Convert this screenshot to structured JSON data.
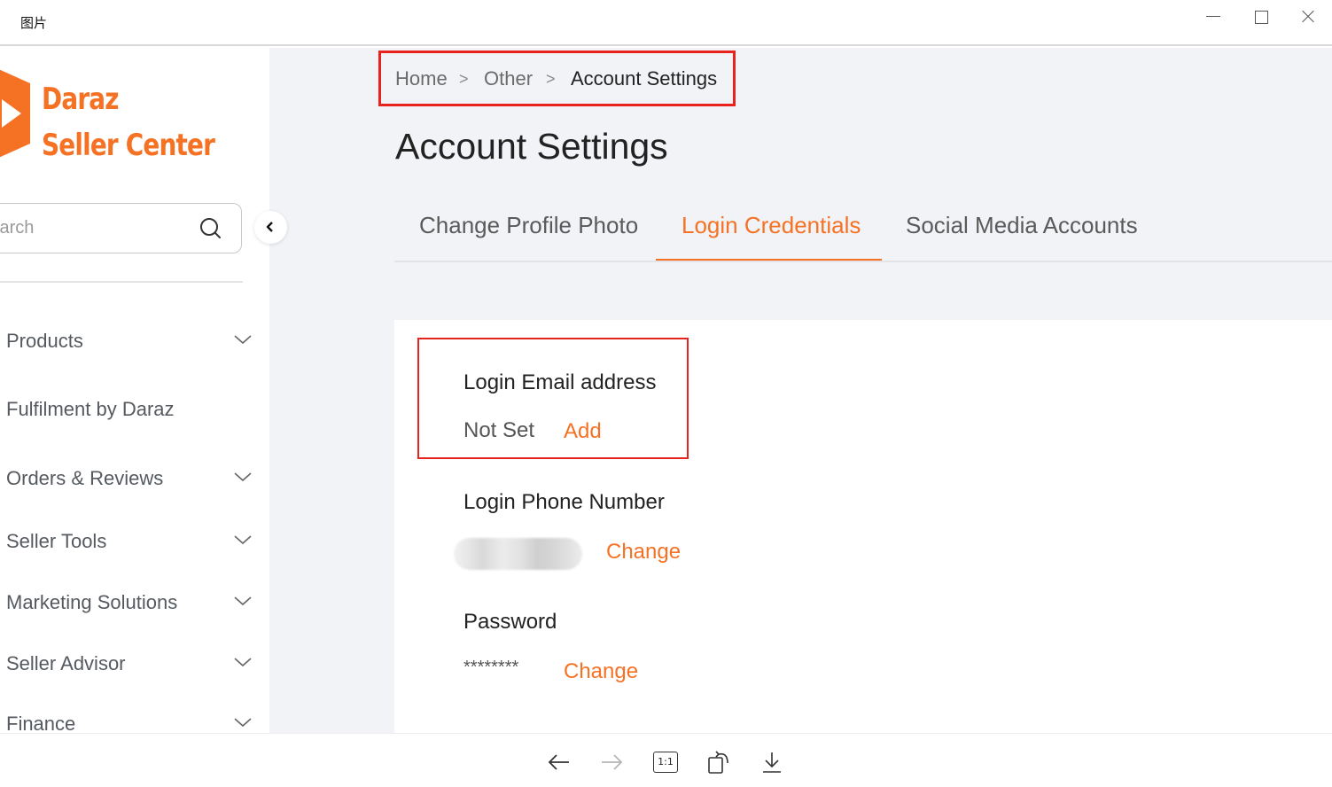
{
  "window": {
    "title": "图片"
  },
  "sidebar": {
    "logo_line1": "Daraz",
    "logo_line2": "Seller Center",
    "search_placeholder": "Search",
    "items": [
      {
        "label": "Products",
        "has_chevron": true
      },
      {
        "label": "Fulfilment by Daraz",
        "has_chevron": false
      },
      {
        "label": "Orders & Reviews",
        "has_chevron": true
      },
      {
        "label": "Seller Tools",
        "has_chevron": true
      },
      {
        "label": "Marketing Solutions",
        "has_chevron": true
      },
      {
        "label": "Seller Advisor",
        "has_chevron": true
      },
      {
        "label": "Finance",
        "has_chevron": true
      }
    ]
  },
  "breadcrumb": {
    "home": "Home",
    "separator": ">",
    "other": "Other",
    "current": "Account Settings"
  },
  "page": {
    "title": "Account Settings"
  },
  "tabs": [
    {
      "label": "Change Profile Photo",
      "active": false
    },
    {
      "label": "Login Credentials",
      "active": true
    },
    {
      "label": "Social Media Accounts",
      "active": false
    }
  ],
  "credentials": {
    "email_label": "Login Email address",
    "email_value": "Not Set",
    "email_action": "Add",
    "phone_label": "Login Phone Number",
    "phone_action": "Change",
    "password_label": "Password",
    "password_value": "********",
    "password_action": "Change"
  },
  "viewer_toolbar": {
    "actual_size_label": "1:1"
  },
  "colors": {
    "brand": "#f57224",
    "highlight_border": "#e8231e",
    "background": "#f2f3f7"
  }
}
